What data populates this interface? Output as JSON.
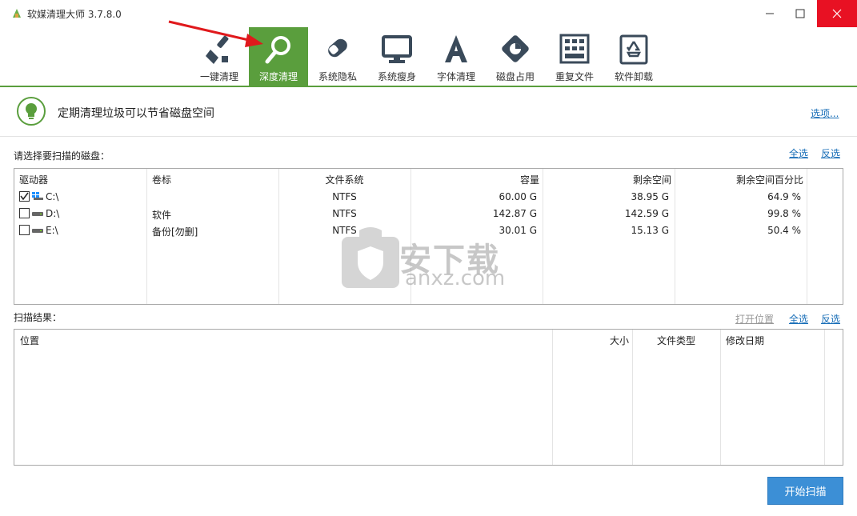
{
  "window": {
    "title": "软媒清理大师 3.7.8.0"
  },
  "toolbar": {
    "tabs": [
      {
        "label": "一键清理",
        "icon": "broom-icon"
      },
      {
        "label": "深度清理",
        "icon": "magnifier-icon",
        "active": true
      },
      {
        "label": "系统隐私",
        "icon": "eraser-icon"
      },
      {
        "label": "系统瘦身",
        "icon": "monitor-icon"
      },
      {
        "label": "字体清理",
        "icon": "font-icon"
      },
      {
        "label": "磁盘占用",
        "icon": "disk-usage-icon"
      },
      {
        "label": "重复文件",
        "icon": "duplicate-grid-icon"
      },
      {
        "label": "软件卸载",
        "icon": "recycle-icon"
      }
    ]
  },
  "tip": {
    "text": "定期清理垃圾可以节省磁盘空间",
    "options_link": "选项..."
  },
  "drive_section": {
    "label": "请选择要扫描的磁盘：",
    "select_all": "全选",
    "invert": "反选",
    "columns": [
      "驱动器",
      "卷标",
      "文件系统",
      "容量",
      "剩余空间",
      "剩余空间百分比"
    ],
    "rows": [
      {
        "drive": "C:\\",
        "label": "",
        "fs": "NTFS",
        "capacity": "60.00 G",
        "free": "38.95 G",
        "percent": "64.9 %",
        "checked": true
      },
      {
        "drive": "D:\\",
        "label": "软件",
        "fs": "NTFS",
        "capacity": "142.87 G",
        "free": "142.59 G",
        "percent": "99.8 %",
        "checked": false
      },
      {
        "drive": "E:\\",
        "label": "备份[勿删]",
        "fs": "NTFS",
        "capacity": "30.01 G",
        "free": "15.13 G",
        "percent": "50.4 %",
        "checked": false
      }
    ]
  },
  "result_section": {
    "label": "扫描结果：",
    "open_location": "打开位置",
    "select_all": "全选",
    "invert": "反选",
    "columns": [
      "位置",
      "大小",
      "文件类型",
      "修改日期"
    ]
  },
  "watermark": {
    "text": "安下载",
    "sub": "anxz.com"
  },
  "start_button": "开始扫描",
  "colors": {
    "accent_green": "#5a9e3d",
    "link_blue": "#1a6fb8",
    "button_blue": "#3c8fd6",
    "close_red": "#e81123"
  }
}
